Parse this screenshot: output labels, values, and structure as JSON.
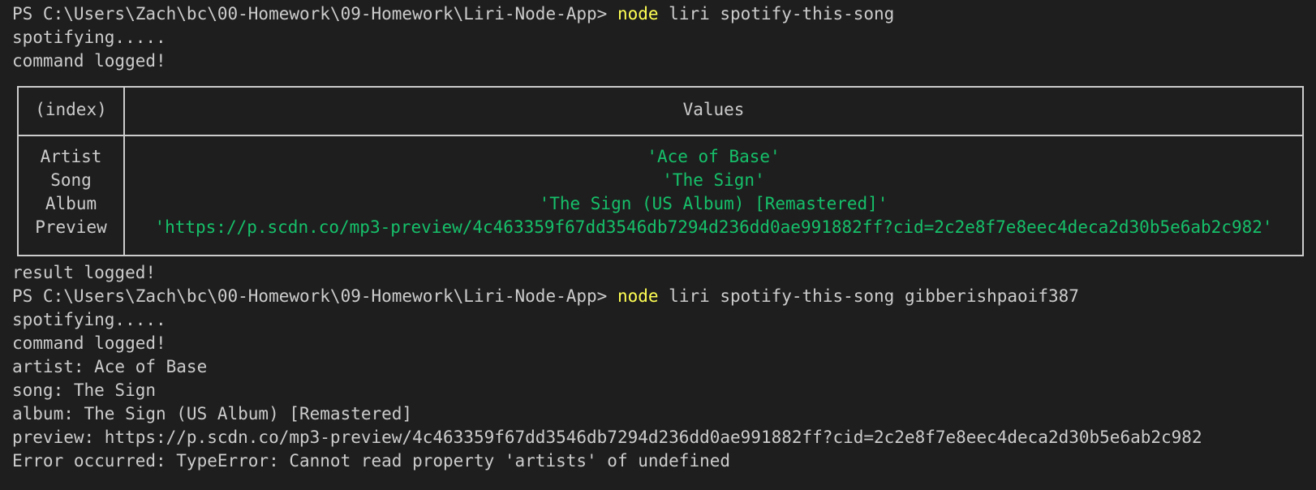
{
  "terminal": {
    "prompt": "PS C:\\Users\\Zach\\bc\\00-Homework\\09-Homework\\Liri-Node-App> ",
    "run1": {
      "cmd_keyword": "node",
      "cmd_args": " liri spotify-this-song",
      "out1": "spotifying.....",
      "out2": "command logged!"
    },
    "table": {
      "index_header": "(index)",
      "values_header": "Values",
      "rows": [
        {
          "index": "Artist",
          "value": "'Ace of Base'"
        },
        {
          "index": "Song",
          "value": "'The Sign'"
        },
        {
          "index": "Album",
          "value": "'The Sign (US Album) [Remastered]'"
        },
        {
          "index": "Preview",
          "value": "'https://p.scdn.co/mp3-preview/4c463359f67dd3546db7294d236dd0ae991882ff?cid=2c2e8f7e8eec4deca2d30b5e6ab2c982'"
        }
      ]
    },
    "result": "result logged!",
    "run2": {
      "cmd_keyword": "node",
      "cmd_args": " liri spotify-this-song gibberishpaoif387",
      "out1": "spotifying.....",
      "out2": "command logged!",
      "artist": "artist: Ace of Base",
      "song": "song: The Sign",
      "album": "album: The Sign (US Album) [Remastered]",
      "preview": "preview: https://p.scdn.co/mp3-preview/4c463359f67dd3546db7294d236dd0ae991882ff?cid=2c2e8f7e8eec4deca2d30b5e6ab2c982",
      "error": "Error occurred: TypeError: Cannot read property 'artists' of undefined"
    }
  },
  "colors": {
    "background": "#1e1e1e",
    "text": "#cccccc",
    "command_keyword": "#ffff54",
    "string_value": "#16c06a"
  }
}
